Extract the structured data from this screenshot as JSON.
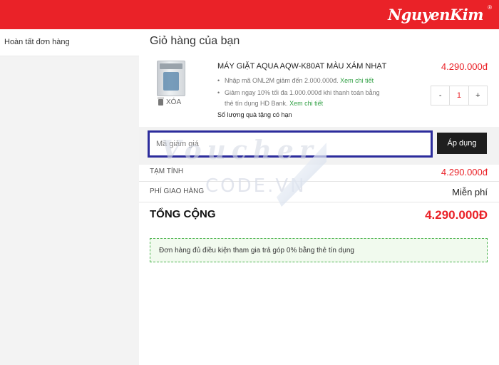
{
  "header": {
    "brand": "NguyenKim",
    "brand_mark": "®",
    "brand_color": "#ea2228"
  },
  "sidebar": {
    "items": [
      {
        "label": "Hoàn tất đơn hàng"
      }
    ]
  },
  "cart": {
    "title": "Giỏ hàng của bạn",
    "item": {
      "name": "MÁY GIẶT AQUA AQW-K80AT MÀU XÁM NHẠT",
      "price": "4.290.000đ",
      "delete_label": "XÓA",
      "promos": [
        {
          "text": "Nhập mã ONL2M giảm đến 2.000.000đ.",
          "link": "Xem chi tiết"
        },
        {
          "text": "Giảm ngay 10% tối đa 1.000.000đ khi thanh toán bằng thẻ tín dụng HD Bank.",
          "link": "Xem chi tiết"
        }
      ],
      "gift_note": "Số lượng quà tặng có hạn",
      "quantity": {
        "minus": "-",
        "value": "1",
        "plus": "+"
      }
    }
  },
  "coupon": {
    "placeholder": "Mã giảm giá",
    "value": "",
    "apply_label": "Áp dụng"
  },
  "summary": {
    "subtotal_label": "TẠM TÍNH",
    "subtotal_value": "4.290.000đ",
    "shipping_label": "PHÍ GIAO HÀNG",
    "shipping_value": "Miễn phí",
    "total_label": "TỔNG CỘNG",
    "total_value": "4.290.000Đ"
  },
  "notice": {
    "text": "Đơn hàng đủ điều kiện tham gia trả góp 0% bằng thẻ tín dụng"
  },
  "watermark": {
    "line1": "Voucher",
    "line2": "CODE.VN"
  }
}
